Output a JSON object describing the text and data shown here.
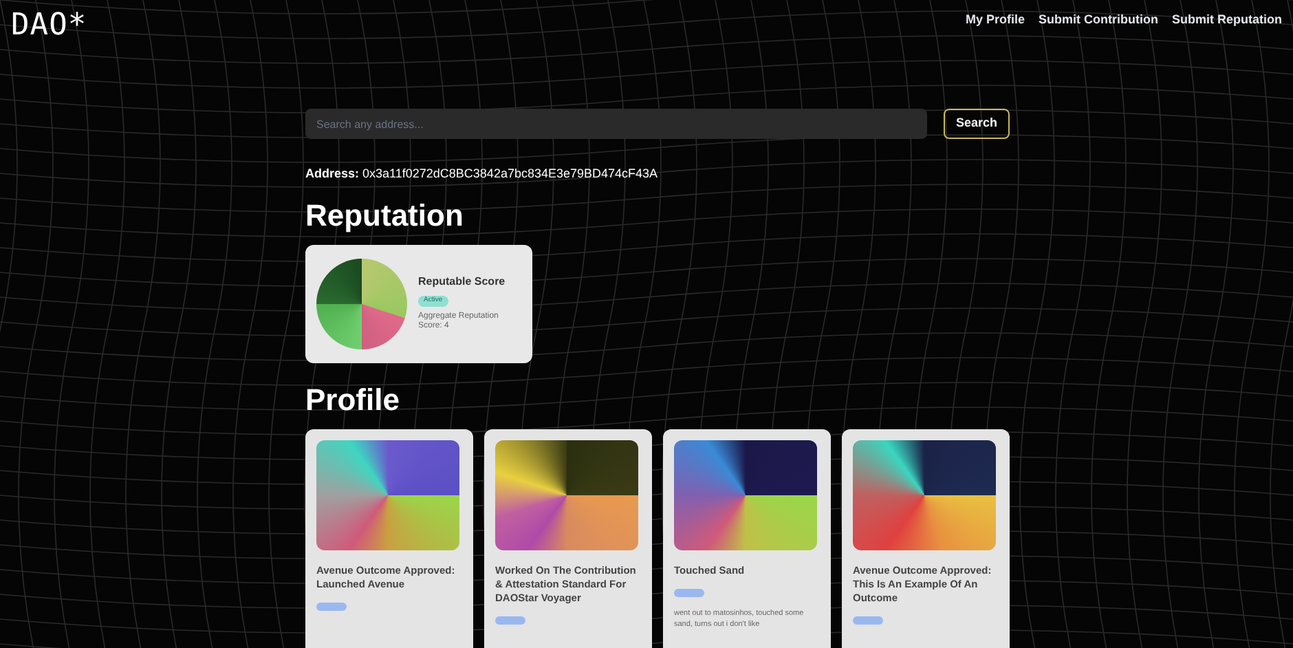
{
  "logo": "DAO*",
  "nav": [
    "My Profile",
    "Submit Contribution",
    "Submit Reputation"
  ],
  "search": {
    "placeholder": "Search any address...",
    "button": "Search"
  },
  "address": {
    "label": "Address:",
    "value": "0x3a11f0272dC8BC3842a7bc834E3e79BD474cF43A"
  },
  "reputation": {
    "heading": "Reputation",
    "card": {
      "title": "Reputable Score",
      "badge": "Active",
      "text": "Aggregate Reputation Score: 4"
    }
  },
  "profile": {
    "heading": "Profile",
    "cards": [
      {
        "title": "Avenue Outcome Approved: Launched Avenue"
      },
      {
        "title": "Worked On The Contribution & Attestation Standard For DAOStar Voyager"
      },
      {
        "title": "Touched Sand",
        "description": "went out to matosinhos, touched some sand, turns out i don't like"
      },
      {
        "title": "Avenue Outcome Approved: This Is An Example Of An Outcome"
      }
    ]
  }
}
